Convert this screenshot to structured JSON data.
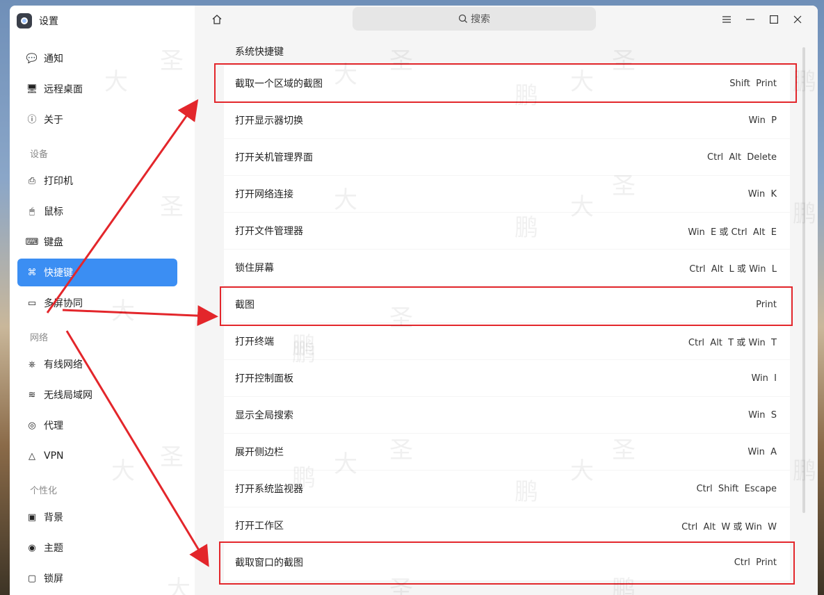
{
  "app": {
    "title": "设置"
  },
  "sidebar": {
    "items": [
      {
        "label": "通知",
        "icon": "chat-bubble-icon"
      },
      {
        "label": "远程桌面",
        "icon": "monitor-icon"
      },
      {
        "label": "关于",
        "icon": "info-icon"
      }
    ],
    "sections": [
      {
        "title": "设备",
        "items": [
          {
            "label": "打印机",
            "icon": "printer-icon"
          },
          {
            "label": "鼠标",
            "icon": "mouse-icon"
          },
          {
            "label": "键盘",
            "icon": "keyboard-icon"
          },
          {
            "label": "快捷键",
            "icon": "shortcut-icon",
            "active": true
          },
          {
            "label": "多屏协同",
            "icon": "multi-screen-icon"
          }
        ]
      },
      {
        "title": "网络",
        "items": [
          {
            "label": "有线网络",
            "icon": "ethernet-icon"
          },
          {
            "label": "无线局域网",
            "icon": "wifi-icon"
          },
          {
            "label": "代理",
            "icon": "proxy-icon"
          },
          {
            "label": "VPN",
            "icon": "vpn-icon"
          }
        ]
      },
      {
        "title": "个性化",
        "items": [
          {
            "label": "背景",
            "icon": "image-icon"
          },
          {
            "label": "主题",
            "icon": "palette-icon"
          },
          {
            "label": "锁屏",
            "icon": "lock-screen-icon"
          }
        ]
      }
    ]
  },
  "search": {
    "placeholder": "搜索"
  },
  "main": {
    "section_title": "系统快捷键",
    "shortcuts": [
      {
        "name": "截取一个区域的截图",
        "keys": "Shift  Print"
      },
      {
        "name": "打开显示器切换",
        "keys": "Win  P"
      },
      {
        "name": "打开关机管理界面",
        "keys": "Ctrl  Alt  Delete"
      },
      {
        "name": "打开网络连接",
        "keys": "Win  K"
      },
      {
        "name": "打开文件管理器",
        "keys": "Win  E 或 Ctrl  Alt  E"
      },
      {
        "name": "锁住屏幕",
        "keys": "Ctrl  Alt  L 或 Win  L"
      },
      {
        "name": "截图",
        "keys": "Print"
      },
      {
        "name": "打开终端",
        "keys": "Ctrl  Alt  T 或 Win  T"
      },
      {
        "name": "打开控制面板",
        "keys": "Win  I"
      },
      {
        "name": "显示全局搜索",
        "keys": "Win  S"
      },
      {
        "name": "展开侧边栏",
        "keys": "Win  A"
      },
      {
        "name": "打开系统监视器",
        "keys": "Ctrl  Shift  Escape"
      },
      {
        "name": "打开工作区",
        "keys": "Ctrl  Alt  W 或 Win  W"
      },
      {
        "name": "截取窗口的截图",
        "keys": "Ctrl  Print"
      }
    ]
  },
  "annotation": {
    "color": "#e3262b"
  },
  "watermark": {
    "chars": [
      "大",
      "圣",
      "鹏"
    ]
  }
}
